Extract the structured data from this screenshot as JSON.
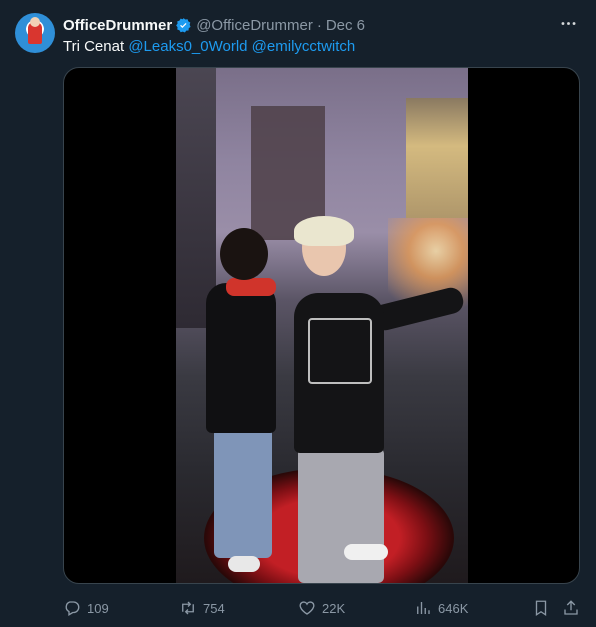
{
  "user": {
    "display_name": "OfficeDrummer",
    "handle": "@OfficeDrummer",
    "date": "Dec 6",
    "separator": "·"
  },
  "tweet": {
    "text": "Tri Cenat",
    "mentions": [
      "@Leaks0_0World",
      "@emilycctwitch"
    ]
  },
  "more_icon": "more-icon",
  "media": {
    "kind": "video"
  },
  "actions": {
    "reply_count": "109",
    "retweet_count": "754",
    "like_count": "22K",
    "view_count": "646K"
  },
  "colors": {
    "background": "#15202b",
    "text": "#f7f9f9",
    "secondary": "#8b98a5",
    "accent": "#1d9bf0",
    "border": "#38444d"
  }
}
